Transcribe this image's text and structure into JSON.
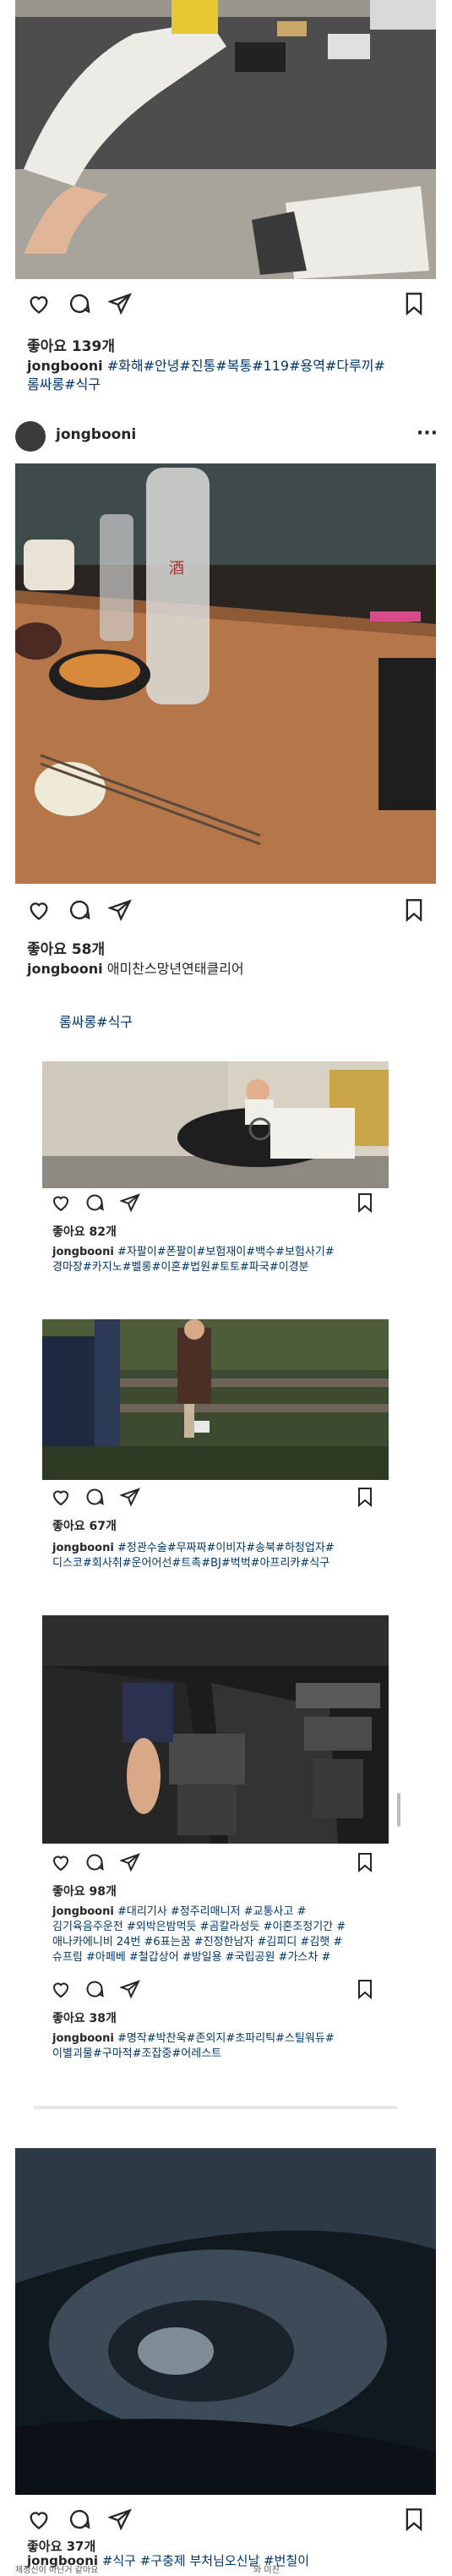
{
  "post1": {
    "likes": "좋아요 139개",
    "username": "jongbooni",
    "tags_line1": "#화해#안녕#진통#복통#119#용역#다루끼#",
    "tags_line2": "롬싸롱#식구"
  },
  "post2": {
    "header_username": "jongbooni",
    "menu": "···",
    "likes": "좋아요 58개",
    "username": "jongbooni",
    "caption": "애미찬스망년연태클리어"
  },
  "post3": {
    "partial_tags": "롬싸롱#식구",
    "likes": "좋아요 82개",
    "username": "jongbooni",
    "tags_line1": "#자팔이#폰팔이#보험재이#백수#보험사기#",
    "tags_line2": "경마장#카지노#벨롱#이혼#법원#토토#파국#이경분"
  },
  "post4": {
    "likes": "좋아요 67개",
    "username": "jongbooni",
    "tags_line1": "#정관수술#무짜짜#이비자#송북#하청업자#",
    "tags_line2": "디스코#회사취#운어어선#트촉#BJ#벅벅#아프리카#식구"
  },
  "post5": {
    "likes": "좋아요 98개",
    "username": "jongbooni",
    "tags_line1": "#대리기사 #정주리매니저 #교통사고 #",
    "tags_line2": "김기육음주운전 #외박은밤먹듯 #곰칼라성듯 #이혼조정기간 #",
    "tags_line3": "애나카에니비 24번 #6표는꿈 #진정한남자 #김피디 #김햇 #",
    "tags_line4": "슈프림 #아페베 #철갑상어 #방일용 #국립공원 #가스차 #"
  },
  "post6": {
    "likes": "좋아요 38개",
    "username": "jongbooni",
    "tags_line1": "#명작#박찬욱#존외지#초파리틱#스틸워듀#",
    "tags_line2": "이별괴물#구마적#조잡중#어레스트"
  },
  "post7": {
    "likes": "좋아요 37개",
    "username": "jongbooni",
    "caption": "#식구 #구충제  부처님오신날 #번칠이"
  },
  "footer": {
    "line1": "제정신이 아닌거 같아요",
    "line2": "와 미친"
  },
  "colors": {
    "text": "#262626",
    "hashtag": "#00376b",
    "background": "#ffffff"
  }
}
